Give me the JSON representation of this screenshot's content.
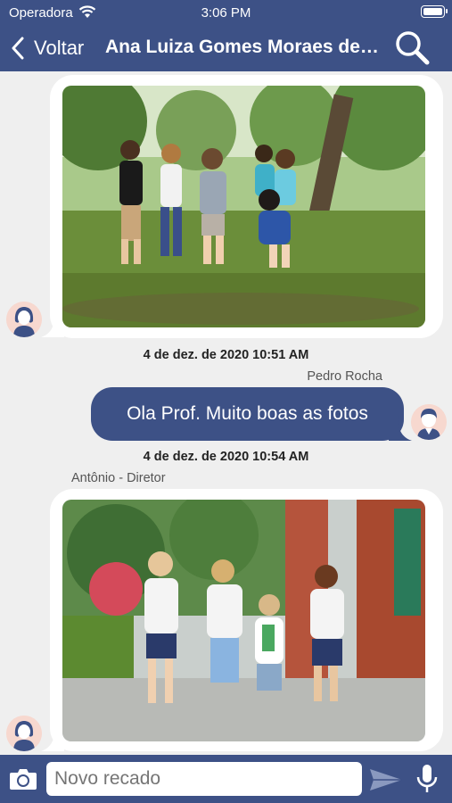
{
  "status": {
    "carrier": "Operadora",
    "time": "3:06 PM"
  },
  "nav": {
    "back_label": "Voltar",
    "title": "Ana Luiza Gomes Moraes de Souza"
  },
  "messages": [
    {
      "type": "image",
      "description": "children playing in park",
      "icon": "user-female-avatar"
    },
    {
      "timestamp": "4 de dez. de 2020 10:51 AM",
      "sender": "Pedro Rocha",
      "text": "Ola Prof. Muito boas as fotos",
      "icon": "user-male-avatar"
    },
    {
      "timestamp": "4 de dez. de 2020 10:54 AM",
      "sender": "Antônio - Diretor",
      "type": "image",
      "icon": "user-female-avatar"
    }
  ],
  "composer": {
    "placeholder": "Novo recado"
  },
  "colors": {
    "primary": "#3d5186",
    "background": "#efefef"
  }
}
